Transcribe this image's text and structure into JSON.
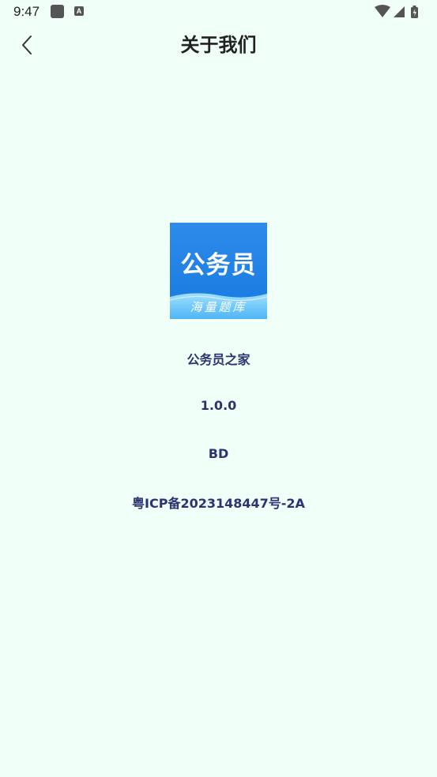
{
  "status_bar": {
    "time": "9:47",
    "a_badge": "A",
    "icons": [
      "app-notification-icon",
      "a-badge-icon",
      "wifi-icon",
      "signal-icon",
      "battery-icon"
    ]
  },
  "header": {
    "title": "关于我们",
    "back_icon": "chevron-left-icon"
  },
  "logo": {
    "title": "公务员",
    "subtitle": "海量题库"
  },
  "app_info": {
    "name": "公务员之家",
    "version": "1.0.0",
    "channel": "BD",
    "icp": "粤ICP备2023148447号-2A"
  },
  "colors": {
    "background": "#f0fff8",
    "info_text": "#2b3472",
    "logo_blue": "#1f82e6"
  }
}
